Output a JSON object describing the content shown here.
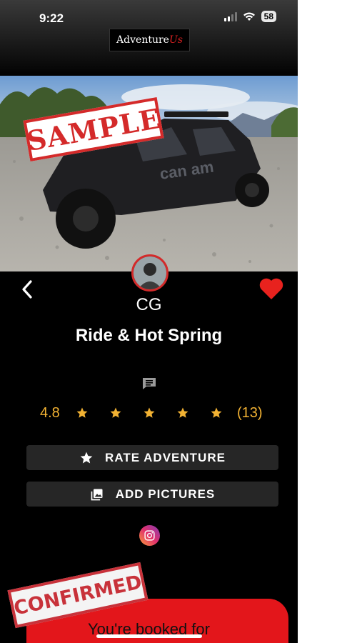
{
  "status": {
    "time": "9:22",
    "battery": "58"
  },
  "header": {
    "logo_main": "Adventure",
    "logo_accent": "Us"
  },
  "hero": {
    "stamp": "SAMPLE"
  },
  "host": {
    "name": "CG"
  },
  "adventure": {
    "title": "Ride & Hot Spring"
  },
  "rating": {
    "value": "4.8",
    "count": "(13)",
    "stars": 5
  },
  "actions": {
    "rate_label": "RATE ADVENTURE",
    "pictures_label": "ADD PICTURES"
  },
  "booking": {
    "stamp": "CONFIRMED",
    "text": "You're booked for"
  },
  "colors": {
    "accent": "#d62020",
    "star": "#f2b233",
    "button_bg": "#262626"
  },
  "icons": [
    "back-icon",
    "heart-icon",
    "chat-icon",
    "star-icon",
    "image-icon",
    "instagram-icon"
  ]
}
